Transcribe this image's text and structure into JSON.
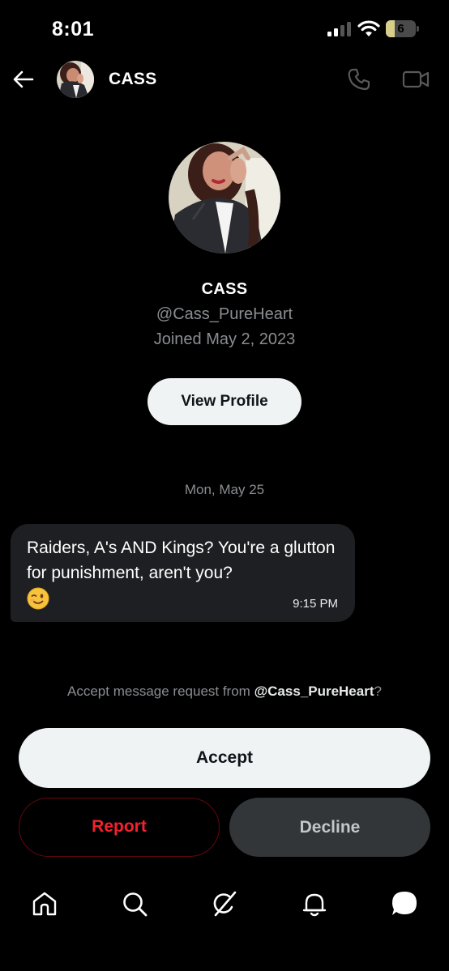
{
  "status_bar": {
    "time": "8:01",
    "battery_level": "6",
    "battery_fraction": 0.06,
    "signal_bars": 2
  },
  "header": {
    "title": "CASS",
    "icons": [
      "back-arrow-icon",
      "phone-icon",
      "video-camera-icon"
    ]
  },
  "profile": {
    "name": "CASS",
    "handle": "@Cass_PureHeart",
    "joined": "Joined May 2, 2023",
    "view_profile_label": "View Profile"
  },
  "conversation": {
    "date_divider": "Mon, May 25",
    "messages": [
      {
        "text": "Raiders, A's AND Kings? You're a glutton for punishment, aren't you?",
        "emoji": "winking-face",
        "time": "9:15 PM"
      }
    ]
  },
  "request": {
    "prompt_prefix": "Accept message request from ",
    "prompt_handle": "@Cass_PureHeart",
    "prompt_suffix": "?",
    "accept_label": "Accept",
    "report_label": "Report",
    "decline_label": "Decline"
  },
  "bottom_nav": {
    "items": [
      "home-icon",
      "search-icon",
      "grok-icon",
      "notifications-icon",
      "messages-icon"
    ],
    "active": "messages-icon"
  },
  "colors": {
    "background": "#000000",
    "accent_light": "#eff3f4",
    "report_red": "#f4212e",
    "muted_text": "#8a8d91",
    "bubble": "#1e1f22"
  }
}
